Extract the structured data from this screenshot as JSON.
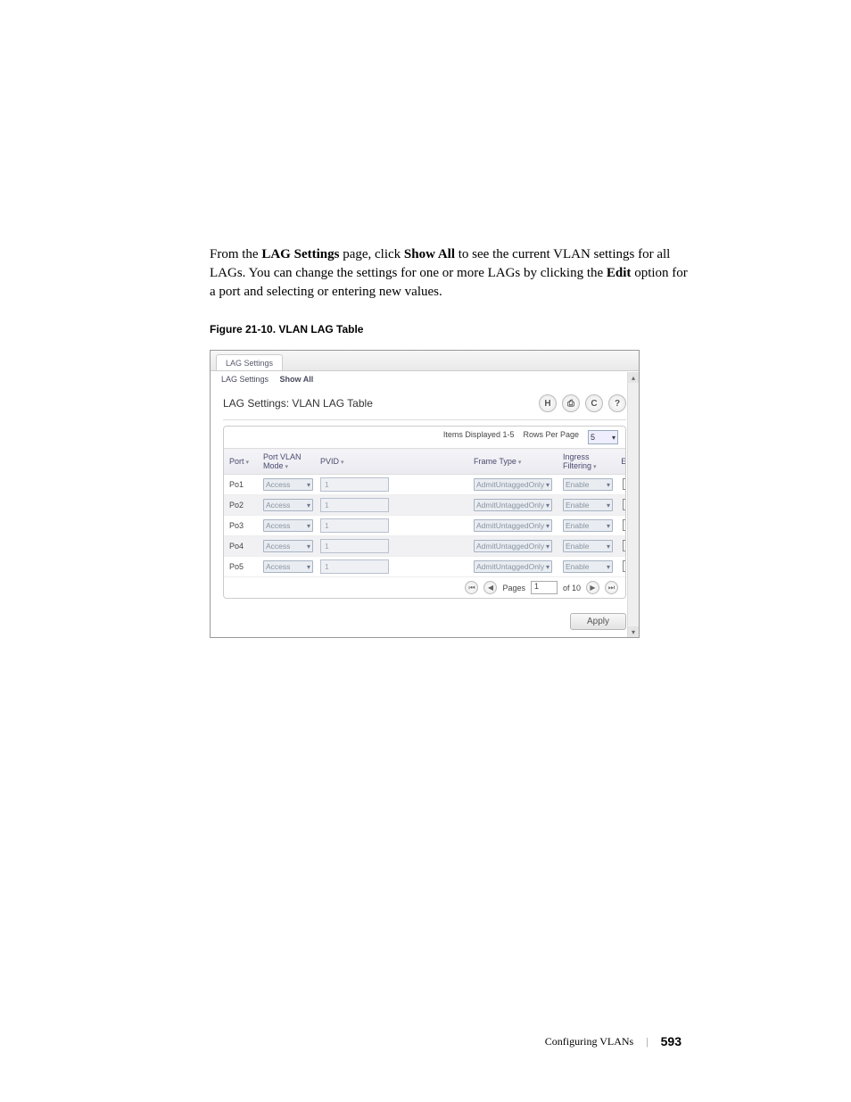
{
  "paragraph": {
    "seg1": "From the ",
    "bold1": "LAG Settings",
    "seg2": " page, click ",
    "bold2": "Show All",
    "seg3": " to see the current VLAN settings for all LAGs. You can change the settings for one or more LAGs by clicking the ",
    "bold3": "Edit",
    "seg4": " option for a port and selecting or entering new values."
  },
  "figure_caption": "Figure 21-10.    VLAN LAG Table",
  "screenshot": {
    "tab_label": "LAG Settings",
    "crumb_left": "LAG Settings",
    "crumb_right": "Show All",
    "panel_title": "LAG Settings: VLAN LAG Table",
    "icons": {
      "save": "H",
      "print": "⎙",
      "refresh": "C",
      "help": "?"
    },
    "items_displayed": "Items Displayed 1-5",
    "rows_per_page_label": "Rows Per Page",
    "rows_per_page_value": "5",
    "headers": {
      "port": "Port",
      "mode": "Port VLAN Mode",
      "pvid": "PVID",
      "frame": "Frame Type",
      "filt": "Ingress Filtering",
      "edit": "Edit"
    },
    "rows": [
      {
        "port": "Po1",
        "mode": "Access",
        "pvid": "1",
        "frame": "AdmitUntaggedOnly",
        "filt": "Enable"
      },
      {
        "port": "Po2",
        "mode": "Access",
        "pvid": "1",
        "frame": "AdmitUntaggedOnly",
        "filt": "Enable"
      },
      {
        "port": "Po3",
        "mode": "Access",
        "pvid": "1",
        "frame": "AdmitUntaggedOnly",
        "filt": "Enable"
      },
      {
        "port": "Po4",
        "mode": "Access",
        "pvid": "1",
        "frame": "AdmitUntaggedOnly",
        "filt": "Enable"
      },
      {
        "port": "Po5",
        "mode": "Access",
        "pvid": "1",
        "frame": "AdmitUntaggedOnly",
        "filt": "Enable"
      }
    ],
    "pager": {
      "pages_label": "Pages",
      "current": "1",
      "of_label": "of 10"
    },
    "apply": "Apply"
  },
  "footer": {
    "chapter": "Configuring VLANs",
    "page": "593"
  }
}
